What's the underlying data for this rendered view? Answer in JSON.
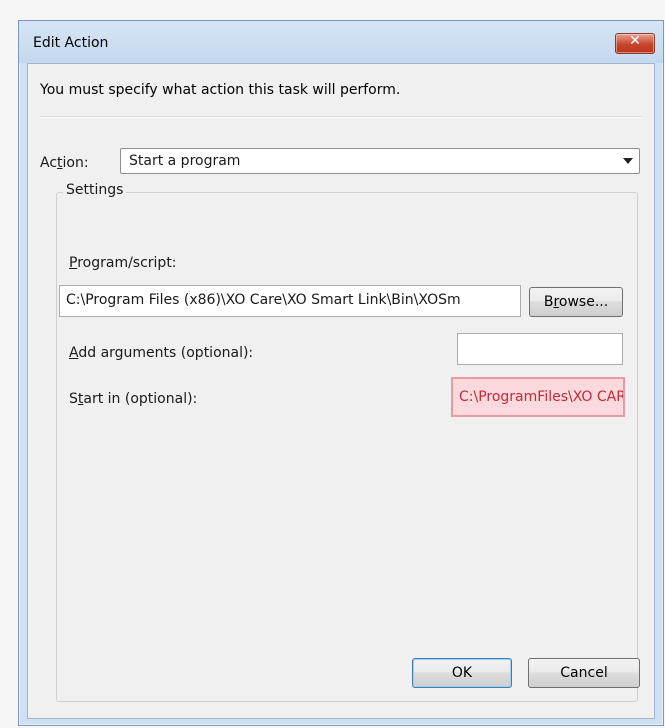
{
  "window": {
    "title": "Edit Action",
    "close_icon": "✕"
  },
  "instruction": "You must specify what action this task will perform.",
  "action": {
    "label_pre": "Ac",
    "label_mnemonic": "t",
    "label_post": "ion:",
    "selected": "Start a program"
  },
  "settings": {
    "legend": "Settings",
    "program": {
      "label_mnemonic": "P",
      "label_rest": "rogram/script:",
      "value": "C:\\Program Files (x86)\\XO Care\\XO Smart Link\\Bin\\XOSm"
    },
    "browse_button": {
      "label_pre": "B",
      "label_mnemonic": "r",
      "label_post": "owse..."
    },
    "arguments": {
      "label_mnemonic": "A",
      "label_rest": "dd arguments (optional):",
      "value": ""
    },
    "start_in": {
      "label_pre": "S",
      "label_mnemonic": "t",
      "label_post": "art in (optional):",
      "value": "C:\\ProgramFiles\\XO CAR"
    }
  },
  "buttons": {
    "ok": "OK",
    "cancel": "Cancel"
  },
  "colors": {
    "highlight_border": "#e89aa2",
    "highlight_fill": "#fbd9dc",
    "highlight_text": "#c12a3a",
    "titlebar": "#cfe0f4"
  }
}
